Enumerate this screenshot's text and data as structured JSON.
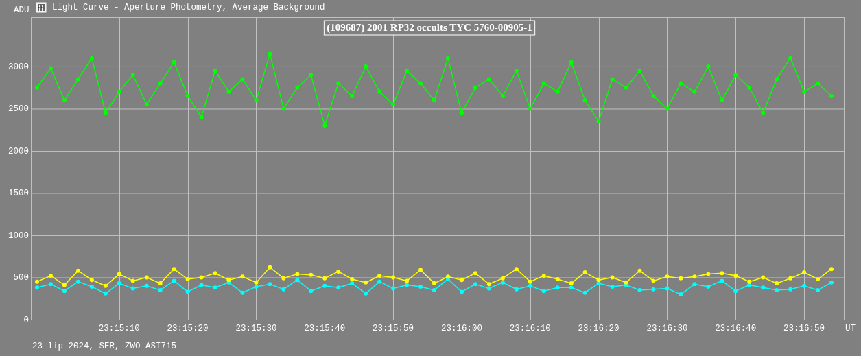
{
  "window": {
    "title": "Light Curve - Aperture Photometry, Average Background"
  },
  "chart": {
    "chart_data": {
      "type": "line",
      "grid": true,
      "title": "(109687) 2001 RP32 occults TYC 5760-00905-1",
      "ylabel": "ADU",
      "xlabel": "UT",
      "xlim": [
        83697.1,
        83815.8
      ],
      "ylim": [
        0,
        3585
      ],
      "yticks": [
        0,
        500,
        1000,
        1500,
        2000,
        2500,
        3000
      ],
      "xticks": [
        {
          "value": 83710,
          "label": "23:15:10"
        },
        {
          "value": 83720,
          "label": "23:15:20"
        },
        {
          "value": 83730,
          "label": "23:15:30"
        },
        {
          "value": 83740,
          "label": "23:15:40"
        },
        {
          "value": 83750,
          "label": "23:15:50"
        },
        {
          "value": 83760,
          "label": "23:16:00"
        },
        {
          "value": 83770,
          "label": "23:16:10"
        },
        {
          "value": 83780,
          "label": "23:16:20"
        },
        {
          "value": 83790,
          "label": "23:16:30"
        },
        {
          "value": 83800,
          "label": "23:16:40"
        },
        {
          "value": 83810,
          "label": "23:16:50"
        }
      ],
      "x": [
        83698,
        83700,
        83702,
        83704,
        83706,
        83708,
        83710,
        83712,
        83714,
        83716,
        83718,
        83720,
        83722,
        83724,
        83726,
        83728,
        83730,
        83732,
        83734,
        83736,
        83738,
        83740,
        83742,
        83744,
        83746,
        83748,
        83750,
        83752,
        83754,
        83756,
        83758,
        83760,
        83762,
        83764,
        83766,
        83768,
        83770,
        83772,
        83774,
        83776,
        83778,
        83780,
        83782,
        83784,
        83786,
        83788,
        83790,
        83792,
        83794,
        83796,
        83798,
        83800,
        83802,
        83804,
        83806,
        83808,
        83810,
        83812,
        83814
      ],
      "series": [
        {
          "color": "#00ff00",
          "marker": "circle",
          "values": [
            2750,
            2980,
            2600,
            2850,
            3100,
            2450,
            2700,
            2900,
            2550,
            2800,
            3050,
            2650,
            2400,
            2950,
            2700,
            2850,
            2600,
            3150,
            2500,
            2750,
            2900,
            2300,
            2800,
            2650,
            3000,
            2700,
            2550,
            2950,
            2800,
            2600,
            3100,
            2450,
            2750,
            2850,
            2650,
            2950,
            2500,
            2800,
            2700,
            3050,
            2600,
            2350,
            2850,
            2750,
            2950,
            2650,
            2500,
            2800,
            2700,
            3000,
            2600,
            2900,
            2750,
            2450,
            2850,
            3100,
            2700,
            2800,
            2650
          ]
        },
        {
          "color": "#00ffff",
          "marker": "circle",
          "values": [
            380,
            420,
            340,
            450,
            390,
            310,
            430,
            370,
            400,
            350,
            460,
            330,
            410,
            380,
            440,
            320,
            390,
            420,
            360,
            470,
            340,
            400,
            380,
            430,
            310,
            450,
            370,
            410,
            390,
            350,
            480,
            330,
            420,
            370,
            440,
            360,
            400,
            340,
            380,
            380,
            320,
            430,
            390,
            410,
            350,
            360,
            370,
            300,
            420,
            390,
            460,
            340,
            410,
            380,
            350,
            360,
            400,
            350,
            440
          ]
        },
        {
          "color": "#ffff00",
          "marker": "circle",
          "values": [
            450,
            520,
            410,
            580,
            470,
            400,
            540,
            460,
            500,
            430,
            600,
            480,
            500,
            550,
            470,
            510,
            440,
            620,
            490,
            540,
            530,
            490,
            570,
            480,
            440,
            520,
            500,
            460,
            590,
            430,
            510,
            470,
            550,
            420,
            490,
            600,
            450,
            520,
            480,
            430,
            560,
            470,
            500,
            440,
            580,
            460,
            510,
            490,
            510,
            540,
            550,
            520,
            450,
            500,
            430,
            490,
            560,
            480,
            600
          ]
        }
      ]
    }
  },
  "footer": {
    "text": "23 lip 2024, SER, ZWO ASI715"
  }
}
